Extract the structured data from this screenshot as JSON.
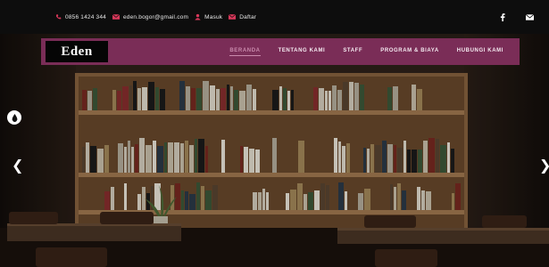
{
  "topbar": {
    "phone": "0856 1424 344",
    "email": "eden.bogor@gmail.com",
    "login": "Masuk",
    "register": "Daftar",
    "social": [
      "facebook-icon",
      "envelope-icon"
    ]
  },
  "navbar": {
    "logo": "Eden",
    "menu": [
      {
        "label": "BERANDA",
        "active": true
      },
      {
        "label": "TENTANG KAMI",
        "active": false
      },
      {
        "label": "STAFF",
        "active": false
      },
      {
        "label": "PROGRAM & BIAYA",
        "active": false
      },
      {
        "label": "HUBUNGI KAMI",
        "active": false
      }
    ]
  },
  "colors": {
    "navbar": "#7a2d57",
    "topbar": "#0d0d0d",
    "icon_accent": "#d9385a",
    "active_menu": "#c98aac"
  },
  "hero": {
    "controls": [
      "droplet-icon",
      "prev-arrow",
      "next-arrow"
    ]
  }
}
